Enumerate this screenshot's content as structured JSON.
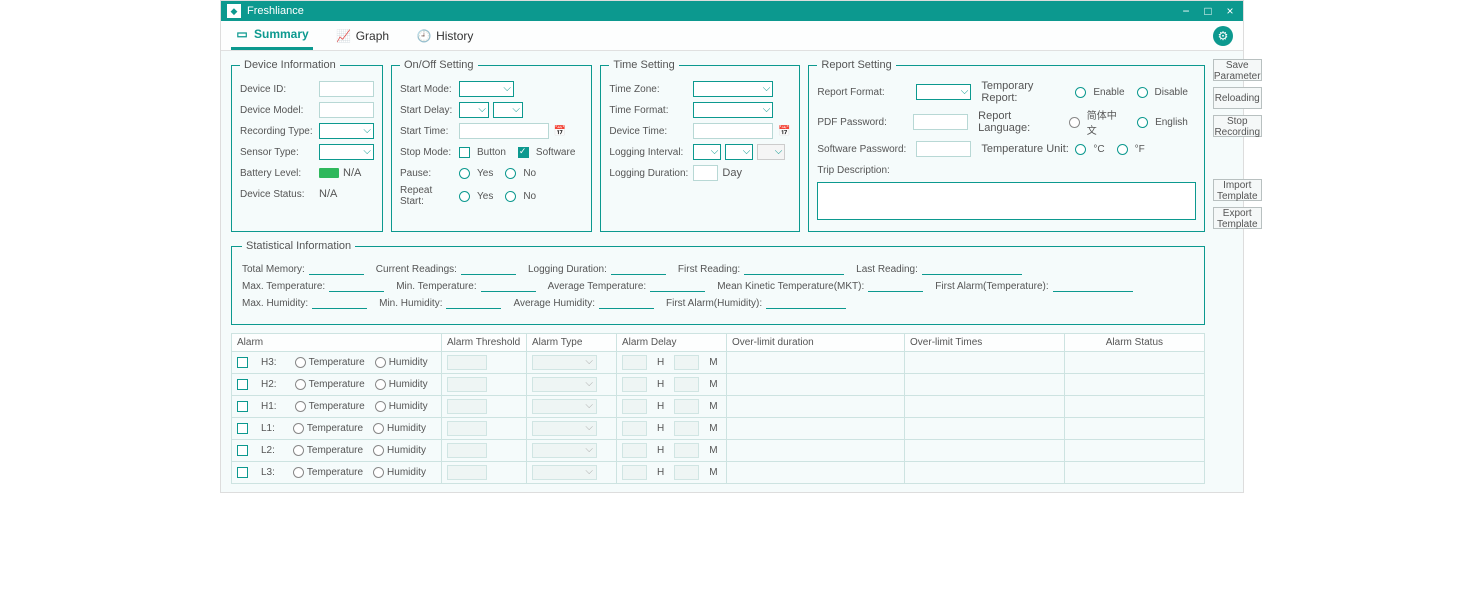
{
  "window": {
    "title": "Freshliance"
  },
  "tabs": {
    "summary": "Summary",
    "graph": "Graph",
    "history": "History"
  },
  "deviceInfo": {
    "legend": "Device Information",
    "deviceId": "Device ID:",
    "deviceModel": "Device Model:",
    "recordingType": "Recording Type:",
    "sensorType": "Sensor Type:",
    "batteryLevel": "Battery Level:",
    "batteryValue": "N/A",
    "deviceStatus": "Device Status:",
    "deviceStatusValue": "N/A"
  },
  "onOff": {
    "legend": "On/Off Setting",
    "startMode": "Start Mode:",
    "startDelay": "Start Delay:",
    "startTime": "Start Time:",
    "stopMode": "Stop Mode:",
    "button": "Button",
    "software": "Software",
    "pause": "Pause:",
    "yes": "Yes",
    "no": "No",
    "repeatStart": "Repeat Start:"
  },
  "timeSetting": {
    "legend": "Time Setting",
    "timeZone": "Time Zone:",
    "timeFormat": "Time Format:",
    "deviceTime": "Device Time:",
    "loggingInterval": "Logging Interval:",
    "loggingDuration": "Logging Duration:",
    "day": "Day"
  },
  "reportSetting": {
    "legend": "Report Setting",
    "reportFormat": "Report Format:",
    "tempReport": "Temporary Report:",
    "enable": "Enable",
    "disable": "Disable",
    "pdfPassword": "PDF Password:",
    "reportLanguage": "Report Language:",
    "langCn": "简体中文",
    "langEn": "English",
    "softwarePassword": "Software Password:",
    "tempUnit": "Temperature Unit:",
    "celsius": "°C",
    "fahrenheit": "°F",
    "tripDescription": "Trip Description:"
  },
  "buttons": {
    "saveParameter": "Save Parameter",
    "reloading": "Reloading",
    "stopRecording": "Stop Recording",
    "importTemplate": "Import Template",
    "exportTemplate": "Export Template"
  },
  "stats": {
    "legend": "Statistical Information",
    "totalMemory": "Total Memory:",
    "currentReadings": "Current Readings:",
    "loggingDuration": "Logging Duration:",
    "firstReading": "First Reading:",
    "lastReading": "Last Reading:",
    "maxTemp": "Max. Temperature:",
    "minTemp": "Min. Temperature:",
    "avgTemp": "Average Temperature:",
    "mkt": "Mean Kinetic Temperature(MKT):",
    "firstAlarmTemp": "First Alarm(Temperature):",
    "maxHum": "Max. Humidity:",
    "minHum": "Min. Humidity:",
    "avgHum": "Average Humidity:",
    "firstAlarmHum": "First Alarm(Humidity):"
  },
  "alarmTable": {
    "headers": {
      "alarm": "Alarm",
      "threshold": "Alarm Threshold",
      "type": "Alarm Type",
      "delay": "Alarm Delay",
      "overDuration": "Over-limit duration",
      "overTimes": "Over-limit Times",
      "status": "Alarm Status"
    },
    "temperature": "Temperature",
    "humidity": "Humidity",
    "h": "H",
    "m": "M",
    "rows": [
      "H3:",
      "H2:",
      "H1:",
      "L1:",
      "L2:",
      "L3:"
    ]
  }
}
